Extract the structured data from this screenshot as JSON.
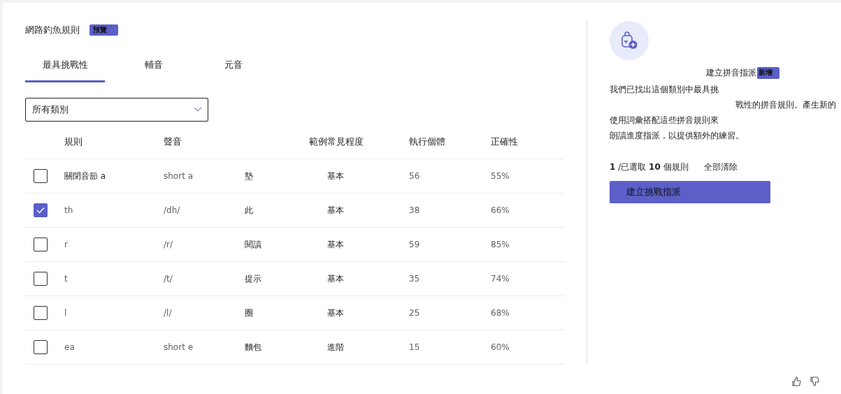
{
  "title": "網路釣魚規則",
  "title_badge": "預覽",
  "tabs": [
    {
      "label": "最具挑戰性",
      "selected": true
    },
    {
      "label": "輔音",
      "selected": false
    },
    {
      "label": "元音",
      "selected": false
    }
  ],
  "filter": {
    "value": "所有類別"
  },
  "table": {
    "columns": [
      "規則",
      "聲音",
      "範例常見程度",
      "執行個體",
      "正確性"
    ],
    "rows": [
      {
        "checked": false,
        "rule": "關閉音節 a",
        "sound": "short a",
        "word": "墊",
        "frequency": "基本",
        "instances": "56",
        "accuracy": "55%"
      },
      {
        "checked": true,
        "rule": "th",
        "sound": "/dh/",
        "word": "此",
        "frequency": "基本",
        "instances": "38",
        "accuracy": "66%"
      },
      {
        "checked": false,
        "rule": "r",
        "sound": "/r/",
        "word": "閱讀",
        "frequency": "基本",
        "instances": "59",
        "accuracy": "85%"
      },
      {
        "checked": false,
        "rule": "t",
        "sound": "/t/",
        "word": "提示",
        "frequency": "基本",
        "instances": "35",
        "accuracy": "74%"
      },
      {
        "checked": false,
        "rule": "l",
        "sound": "/l/",
        "word": "圈",
        "frequency": "基本",
        "instances": "25",
        "accuracy": "68%"
      },
      {
        "checked": false,
        "rule": "ea",
        "sound": "short e",
        "word": "麵包",
        "frequency": "進階",
        "instances": "15",
        "accuracy": "60%"
      }
    ]
  },
  "panel": {
    "heading": "建立拼音指派",
    "heading_badge": "新增",
    "description": [
      {
        "text": "我們已找出這個類別中最具挑",
        "indented": false
      },
      {
        "text": "戰性的拼音規則。產生新的",
        "indented": true
      },
      {
        "text": "使用詞彙搭配這些拼音規則來",
        "indented": false
      },
      {
        "text": "朗讀進度指派，以提供額外的練習。",
        "indented": false
      }
    ],
    "selection": "**1** /已選取 **10** 個規則",
    "clear_all": "全部清除",
    "create_button": "建立挑戰指派"
  }
}
